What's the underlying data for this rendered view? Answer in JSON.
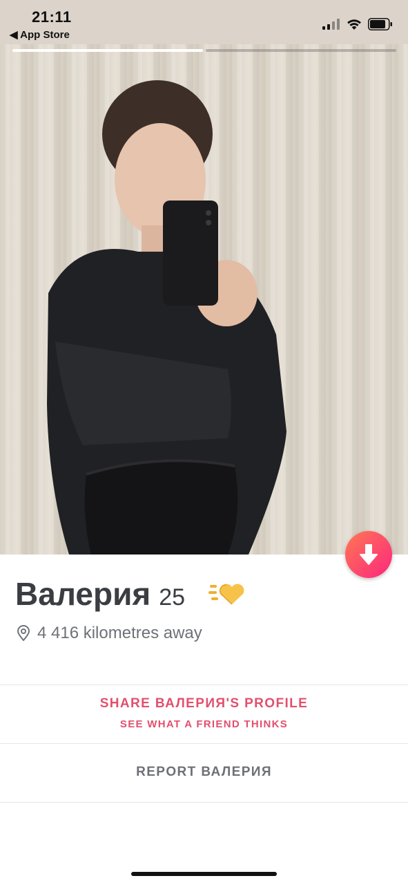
{
  "status_bar": {
    "time": "21:11",
    "back_app": "◀ App Store",
    "signal_icon": "cellular-signal-icon",
    "wifi_icon": "wifi-icon",
    "battery_icon": "battery-icon"
  },
  "photo": {
    "segments_total": 2,
    "active_segment": 1
  },
  "profile": {
    "name": "Валерия",
    "age": "25",
    "distance": "4 416 kilometres away",
    "info_icon": "arrow-down-icon",
    "badge_icon": "super-like-heart-icon"
  },
  "share": {
    "label": "SHARE ВАЛЕРИЯ'S PROFILE",
    "sublabel": "SEE WHAT A FRIEND THINKS"
  },
  "report": {
    "label": "REPORT ВАЛЕРИЯ"
  },
  "colors": {
    "accent": "#e24f6d",
    "gradient_start": "#ff7854",
    "gradient_end": "#fd267d",
    "text_dark": "#3a3d42",
    "text_muted": "#6e7177"
  }
}
